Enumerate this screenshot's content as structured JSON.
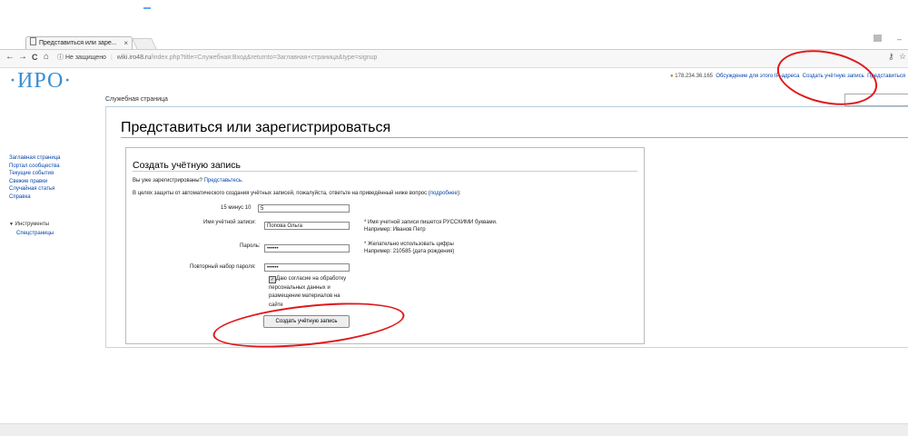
{
  "browser": {
    "tab_title": "Представиться или заре...",
    "tab_close": "×",
    "security_label": "Не защищено",
    "url_host": "wiki.iro48.ru",
    "url_path": "/index.php?title=Служебная:Вход&returnto=Заглавная+страница&type=signup",
    "nav_back": "←",
    "nav_forward": "→",
    "nav_reload": "C",
    "nav_home": "⌂",
    "info": "ⓘ",
    "star": "☆",
    "key": "⚷",
    "win_min": "–",
    "win_user": "👤"
  },
  "wiki": {
    "logo_text": "·ИРО·",
    "personal": {
      "ip": "178.234.36.165",
      "talk": "Обсуждение для этого IP-адреса",
      "create_account": "Создать учётную запись",
      "login": "Представиться"
    },
    "tab_special": "Служебная страница",
    "page_title": "Представиться или зарегистрироваться",
    "sidebar": {
      "items": [
        "Заглавная страница",
        "Портал сообщества",
        "Текущие события",
        "Свежие правки",
        "Случайная статья",
        "Справка"
      ],
      "tools_label": "Инструменты",
      "tools_items": [
        "Спецстраницы"
      ]
    }
  },
  "form": {
    "title": "Создать учётную запись",
    "already_registered": "Вы уже зарегистрированы?",
    "login_link": "Представьтесь.",
    "captcha_info": "В целях защиты от автоматического создания учётных записей, пожалуйста, ответьте на приведённый ниже вопрос (",
    "captcha_more": "подробнее",
    "captcha_info_end": "):",
    "captcha_question": "15 минус 10",
    "captcha_answer": "5",
    "username_label": "Имя учётной записи:",
    "username_value": "Попова Ольга",
    "username_hint_1": "* Имя учетной записи пишется РУССКИМИ буквами.",
    "username_hint_2": "Например: Иванов Петр",
    "password_label": "Пароль:",
    "password_value": "••••••",
    "password_hint_1": "* Желательно использовать цифры",
    "password_hint_2": "Например: 210585 (дата рождения)",
    "retype_label": "Повторный набор пароля:",
    "retype_value": "••••••",
    "consent_lines": [
      "Даю согласие на обработку",
      "персональных данных и",
      "размещение материалов на",
      "сайте"
    ],
    "submit_label": "Создать учётную запись"
  },
  "annotations": {
    "color": "#e0181a"
  }
}
